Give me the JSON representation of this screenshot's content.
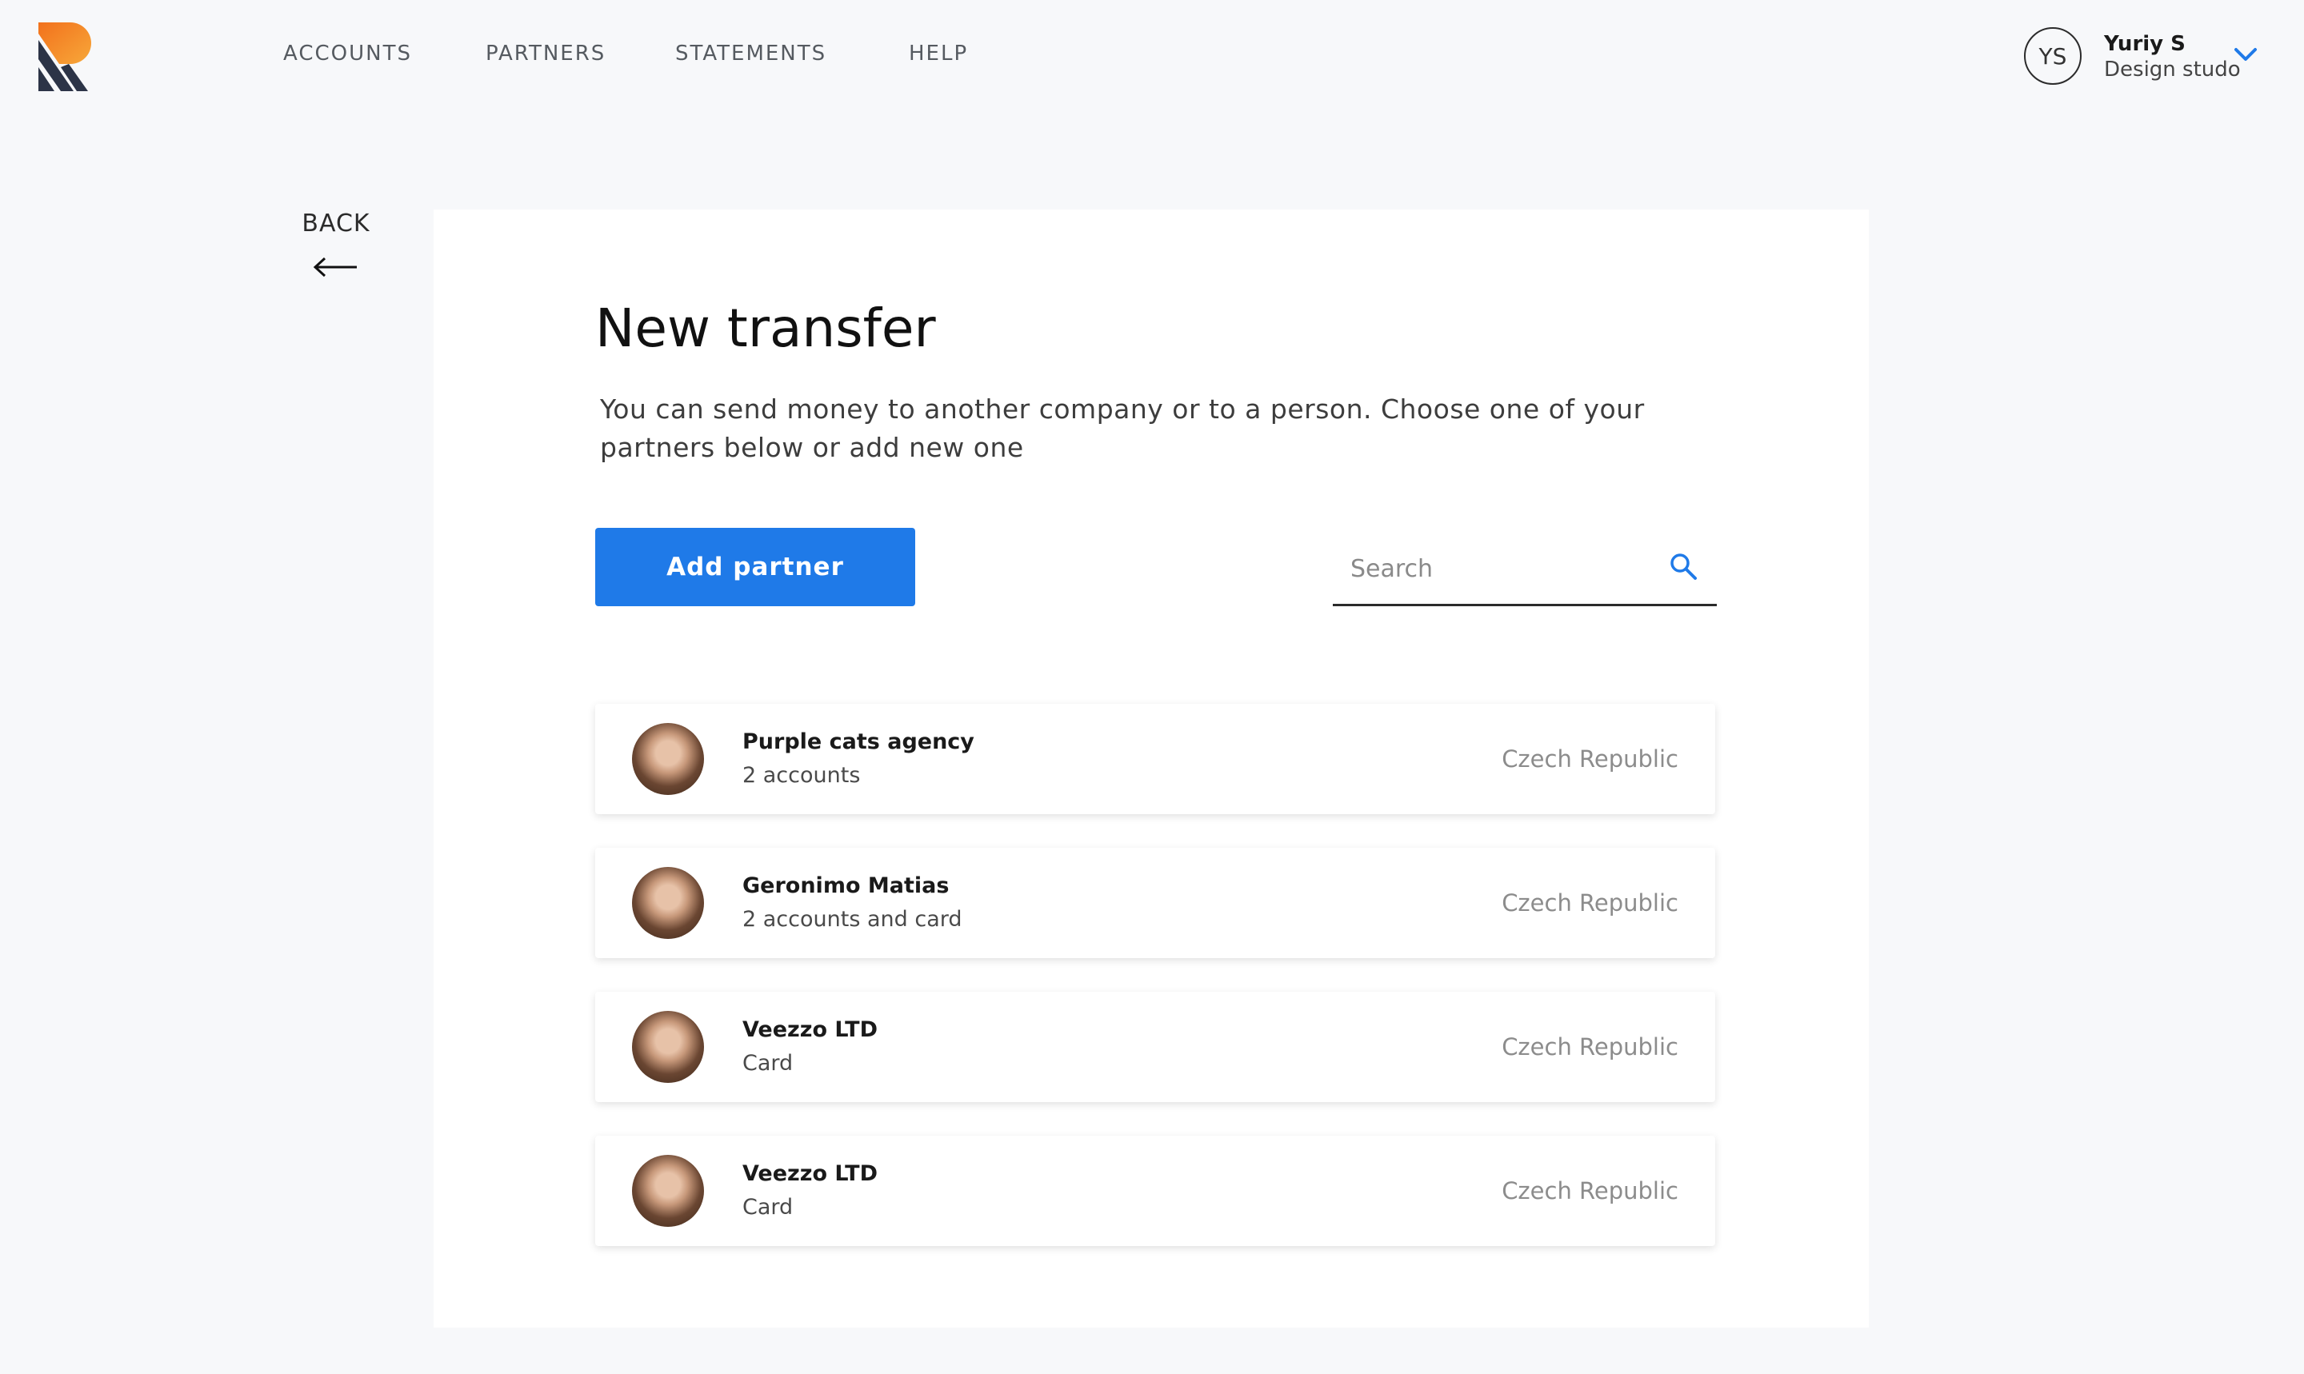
{
  "nav": {
    "items": [
      {
        "label": "ACCOUNTS"
      },
      {
        "label": "PARTNERS"
      },
      {
        "label": "STATEMENTS"
      },
      {
        "label": "HELP"
      }
    ]
  },
  "user": {
    "initials": "YS",
    "name": "Yuriy S",
    "company": "Design studo"
  },
  "back": {
    "label": "BACK"
  },
  "page": {
    "title": "New transfer",
    "description": "You can send money to another company or to a person. Choose one of your partners below or add new one",
    "add_button": "Add partner",
    "search_placeholder": "Search"
  },
  "partners": [
    {
      "name": "Purple cats agency",
      "detail": "2 accounts",
      "country": "Czech Republic"
    },
    {
      "name": "Geronimo Matias",
      "detail": "2 accounts and card",
      "country": "Czech Republic"
    },
    {
      "name": "Veezzo LTD",
      "detail": "Card",
      "country": "Czech Republic"
    },
    {
      "name": "Veezzo LTD",
      "detail": "Card",
      "country": "Czech Republic"
    }
  ],
  "colors": {
    "accent": "#1f7ae8",
    "logo_orange": "#f2711c",
    "logo_navy": "#2c3447",
    "background": "#f7f8fa"
  }
}
